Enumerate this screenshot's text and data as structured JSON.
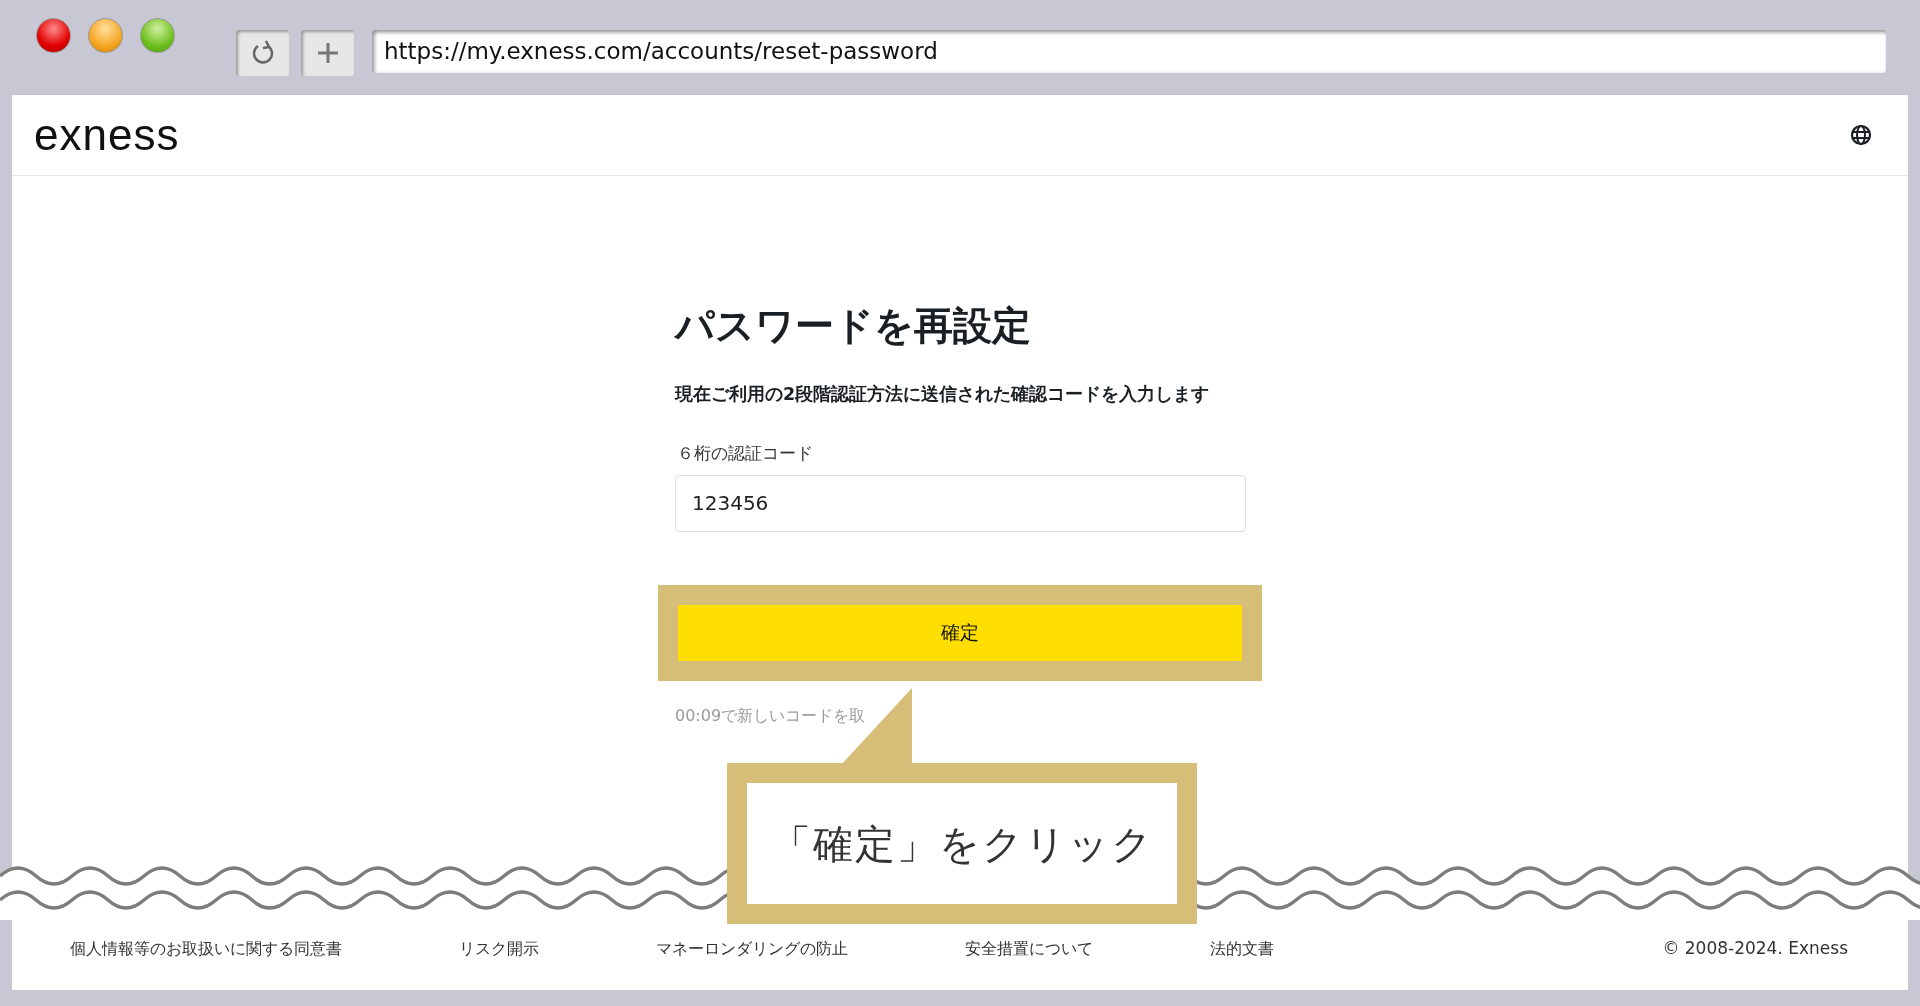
{
  "browser": {
    "url": "https://my.exness.com/accounts/reset-password"
  },
  "header": {
    "logo": "exness"
  },
  "form": {
    "title": "パスワードを再設定",
    "subtitle": "現在ご利用の2段階認証方法に送信された確認コードを入力します",
    "field_label": "６桁の認証コード",
    "field_value": "123456",
    "button": "確定",
    "timer_text": "00:09で新しいコードを取"
  },
  "callout": {
    "text": "「確定」をクリック"
  },
  "footer": {
    "links": [
      "個人情報等のお取扱いに関する同意書",
      "リスク開示",
      "マネーロンダリングの防止",
      "安全措置について",
      "法的文書"
    ],
    "copyright": "© 2008-2024. Exness"
  }
}
